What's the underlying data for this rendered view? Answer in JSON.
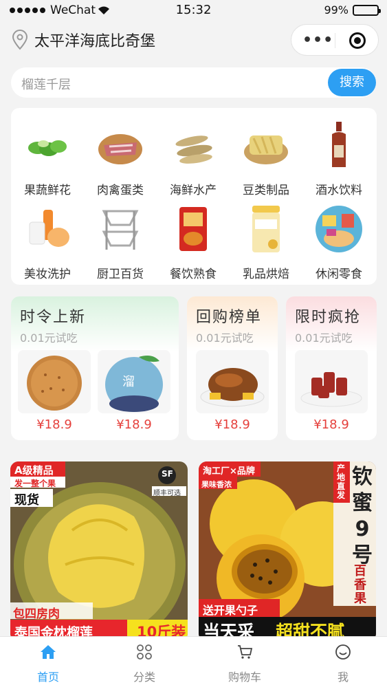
{
  "status_bar": {
    "carrier": "WeChat",
    "time": "15:32",
    "battery": "99%"
  },
  "location": {
    "name": "太平洋海底比奇堡"
  },
  "search": {
    "placeholder": "榴莲千层",
    "button": "搜索"
  },
  "categories": [
    {
      "label": "果蔬鲜花",
      "icon": "vegetables-icon"
    },
    {
      "label": "肉禽蛋类",
      "icon": "meat-icon"
    },
    {
      "label": "海鲜水产",
      "icon": "fish-icon"
    },
    {
      "label": "豆类制品",
      "icon": "tofu-icon"
    },
    {
      "label": "酒水饮料",
      "icon": "liquor-icon"
    },
    {
      "label": "美妆洗护",
      "icon": "cosmetics-icon"
    },
    {
      "label": "厨卫百货",
      "icon": "shelf-icon"
    },
    {
      "label": "餐饮熟食",
      "icon": "snack-bag-icon"
    },
    {
      "label": "乳品烘焙",
      "icon": "milk-powder-icon"
    },
    {
      "label": "休闲零食",
      "icon": "snacks-icon"
    }
  ],
  "promos": [
    {
      "title": "时令上新",
      "subtitle": "0.01元试吃",
      "prices": [
        "¥18.9",
        "¥18.9"
      ]
    },
    {
      "title": "回购榜单",
      "subtitle": "0.01元试吃",
      "prices": [
        "¥18.9"
      ]
    },
    {
      "title": "限时疯抢",
      "subtitle": "0.01元试吃",
      "prices": [
        "¥18.9"
      ]
    }
  ],
  "products": [
    {
      "badge_top": "A级精品",
      "badge_sub": "发一整个果",
      "tag": "现货",
      "sf": "顺丰可选",
      "bottom1": "包四房肉",
      "bottom2": "泰国金枕榴莲",
      "weight": "10斤装"
    },
    {
      "badge_top": "淘工厂×品牌",
      "tag": "果味香浓",
      "side": "产地直发",
      "vtitle": "钦蜜9号",
      "vsub": "百香果",
      "promo": "送开果勺子",
      "bottom1": "当天采",
      "bottom2": "超甜不腻"
    }
  ],
  "tabbar": [
    {
      "label": "首页",
      "icon": "home-icon",
      "active": true
    },
    {
      "label": "分类",
      "icon": "category-icon",
      "active": false
    },
    {
      "label": "购物车",
      "icon": "cart-icon",
      "active": false
    },
    {
      "label": "我",
      "icon": "profile-icon",
      "active": false
    }
  ],
  "colors": {
    "accent": "#2d9ff3",
    "price": "#e5403c"
  }
}
